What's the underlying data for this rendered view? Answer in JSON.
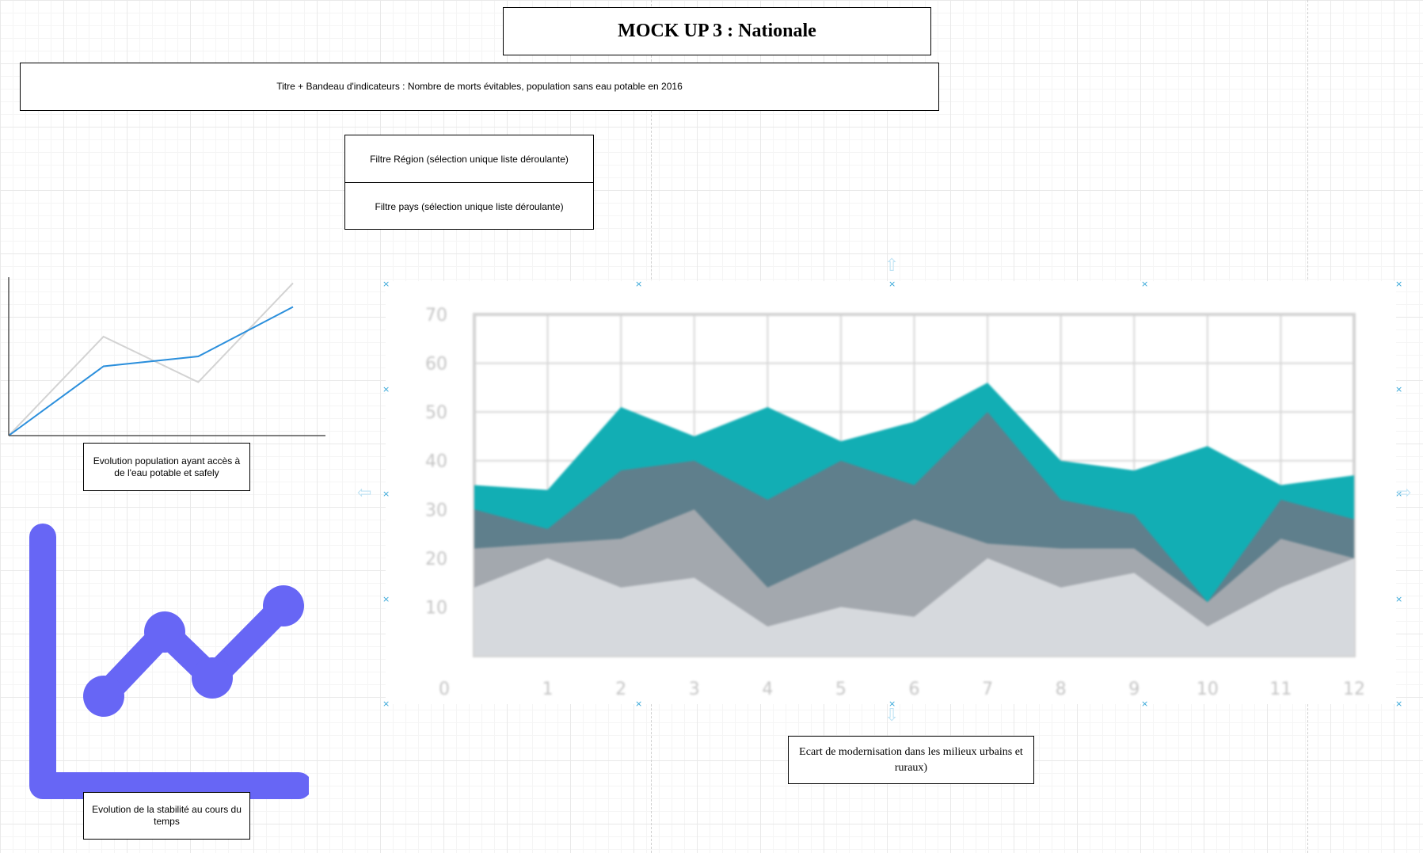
{
  "header": {
    "title": "MOCK UP 3 : Nationale"
  },
  "banner": {
    "text": "Titre + Bandeau d'indicateurs : Nombre de morts évitables, population sans eau potable en 2016"
  },
  "filters": {
    "region": "Filtre Région (sélection unique liste déroulante)",
    "country": "Filtre pays (sélection unique liste déroulante)"
  },
  "widgets": {
    "line_chart_caption": "Evolution population ayant accès à de l'eau potable et safely",
    "stability_caption": "Evolution de la stabilité au cours du temps",
    "area_chart_caption": "Ecart de modernisation dans les milieux urbains et ruraux)"
  },
  "icons": {
    "stability": "trend-line-chart-icon"
  },
  "colors": {
    "line_blue": "#2b8fdc",
    "line_gray": "#d3d3d3",
    "icon_purple": "#6766f5",
    "area_teal": "#12aeb4",
    "area_slate": "#5f7f8c",
    "area_gray": "#a3a8ae",
    "area_light": "#d6d9dd"
  },
  "chart_data": [
    {
      "type": "line",
      "title": "",
      "x": [
        0,
        1,
        2,
        3
      ],
      "series": [
        {
          "values": [
            0,
            35,
            40,
            65
          ],
          "color": "#2b8fdc"
        },
        {
          "values": [
            0,
            50,
            27,
            77
          ],
          "color": "#d3d3d3"
        }
      ],
      "ylim": [
        0,
        80
      ],
      "grid": false
    },
    {
      "type": "area",
      "title": "",
      "x": [
        0,
        1,
        2,
        3,
        4,
        5,
        6,
        7,
        8,
        9,
        10,
        11,
        12
      ],
      "x_tick_labels": [
        "0",
        "1",
        "2",
        "3",
        "4",
        "5",
        "6",
        "7",
        "8",
        "9",
        "10",
        "11",
        "12"
      ],
      "y_ticks": [
        10,
        20,
        30,
        40,
        50,
        60,
        70
      ],
      "xlim": [
        0,
        12
      ],
      "ylim": [
        0,
        70
      ],
      "grid": true,
      "stacked_boundaries_note": "top boundary of each stacked band (cumulative, data units)",
      "series": [
        {
          "color": "#d6d9dd",
          "top": [
            14,
            20,
            14,
            16,
            6,
            10,
            8,
            20,
            14,
            17,
            6,
            14,
            20
          ]
        },
        {
          "color": "#a3a8ae",
          "top": [
            22,
            23,
            24,
            30,
            14,
            21,
            28,
            23,
            22,
            22,
            11,
            24,
            20
          ]
        },
        {
          "color": "#5f7f8c",
          "top": [
            30,
            26,
            38,
            40,
            32,
            40,
            35,
            50,
            32,
            29,
            11,
            32,
            28
          ]
        },
        {
          "color": "#12aeb4",
          "top": [
            35,
            34,
            51,
            45,
            51,
            44,
            48,
            56,
            40,
            38,
            43,
            35,
            37
          ]
        }
      ]
    }
  ]
}
